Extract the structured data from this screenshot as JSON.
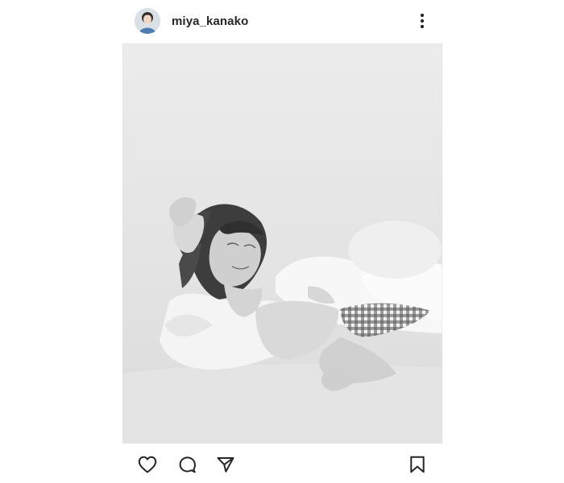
{
  "post": {
    "username": "miya_kanako",
    "avatar_icon": "profile-avatar",
    "more_icon": "more-vertical-icon",
    "photo_style": "black-and-white"
  },
  "actions": {
    "like_icon": "heart-icon",
    "comment_icon": "comment-icon",
    "share_icon": "send-icon",
    "save_icon": "bookmark-icon"
  },
  "colors": {
    "text": "#262626",
    "background": "#ffffff",
    "icon_stroke": "#262626"
  }
}
